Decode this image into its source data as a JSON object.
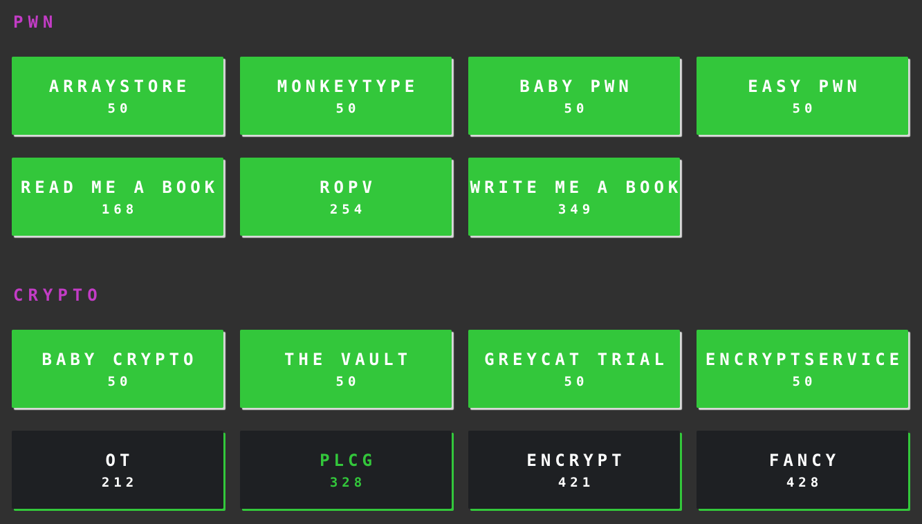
{
  "categories": [
    {
      "title": "PWN",
      "challenges": [
        {
          "name": "ARRAYSTORE",
          "points": "50",
          "state": "solved"
        },
        {
          "name": "MONKEYTYPE",
          "points": "50",
          "state": "solved"
        },
        {
          "name": "BABY PWN",
          "points": "50",
          "state": "solved"
        },
        {
          "name": "EASY PWN",
          "points": "50",
          "state": "solved"
        },
        {
          "name": "READ ME A BOOK",
          "points": "168",
          "state": "solved"
        },
        {
          "name": "ROPV",
          "points": "254",
          "state": "solved"
        },
        {
          "name": "WRITE ME A BOOK",
          "points": "349",
          "state": "solved"
        }
      ]
    },
    {
      "title": "CRYPTO",
      "challenges": [
        {
          "name": "BABY CRYPTO",
          "points": "50",
          "state": "solved"
        },
        {
          "name": "THE VAULT",
          "points": "50",
          "state": "solved"
        },
        {
          "name": "GREYCAT TRIAL",
          "points": "50",
          "state": "solved"
        },
        {
          "name": "ENCRYPTSERVICE",
          "points": "50",
          "state": "solved"
        },
        {
          "name": "OT",
          "points": "212",
          "state": "unsolved"
        },
        {
          "name": "PLCG",
          "points": "328",
          "state": "unsolved-highlight"
        },
        {
          "name": "ENCRYPT",
          "points": "421",
          "state": "unsolved"
        },
        {
          "name": "FANCY",
          "points": "428",
          "state": "unsolved"
        }
      ]
    }
  ],
  "colors": {
    "background": "#303030",
    "category_title": "#c33cc6",
    "solved_card": "#33c73b",
    "unsolved_card": "#1e2023",
    "card_text": "#ffffff",
    "highlight_text": "#33c73b"
  }
}
